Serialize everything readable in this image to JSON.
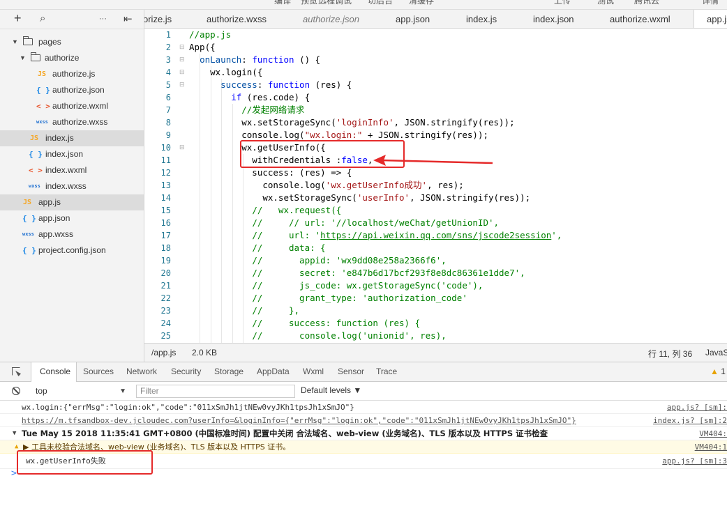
{
  "menu_strip": [
    "编译",
    "预览",
    "远程调试",
    "切后台",
    "清缓存",
    "上传",
    "测试",
    "腾讯云",
    "详情"
  ],
  "explorer": {
    "toolbar": {
      "add": "+",
      "search": "⌕",
      "more": "···",
      "collapse": "⇤"
    },
    "tree": [
      {
        "label": "pages",
        "type": "folder",
        "level": 0,
        "open": true
      },
      {
        "label": "authorize",
        "type": "folder",
        "level": 1,
        "open": true
      },
      {
        "label": "authorize.js",
        "type": "js",
        "level": 2
      },
      {
        "label": "authorize.json",
        "type": "json",
        "level": 2
      },
      {
        "label": "authorize.wxml",
        "type": "wxml",
        "level": 2
      },
      {
        "label": "authorize.wxss",
        "type": "wxss",
        "level": 2
      },
      {
        "label": "index.js",
        "type": "js",
        "level": 1,
        "selected": true
      },
      {
        "label": "index.json",
        "type": "json",
        "level": 1
      },
      {
        "label": "index.wxml",
        "type": "wxml",
        "level": 1
      },
      {
        "label": "index.wxss",
        "type": "wxss",
        "level": 1
      },
      {
        "label": "app.js",
        "type": "js",
        "level": 0,
        "selected": true
      },
      {
        "label": "app.json",
        "type": "json",
        "level": 0
      },
      {
        "label": "app.wxss",
        "type": "wxss",
        "level": 0
      },
      {
        "label": "project.config.json",
        "type": "json",
        "level": 0
      }
    ],
    "icons": {
      "js": "JS",
      "json": "{ }",
      "wxml": "< >",
      "wxss": "wxss"
    }
  },
  "tabs": [
    {
      "label": "orize.js"
    },
    {
      "label": "authorize.wxss"
    },
    {
      "label": "authorize.json",
      "italic": true
    },
    {
      "label": "app.json"
    },
    {
      "label": "index.js"
    },
    {
      "label": "index.json"
    },
    {
      "label": "authorize.wxml"
    },
    {
      "label": "app.js",
      "active": true
    }
  ],
  "editor": {
    "line_numbers": [
      "1",
      "2",
      "3",
      "4",
      "5",
      "6",
      "7",
      "8",
      "9",
      "10",
      "11",
      "12",
      "13",
      "14",
      "15",
      "16",
      "17",
      "18",
      "19",
      "20",
      "21",
      "22",
      "23",
      "24",
      "25"
    ]
  },
  "statusbar": {
    "path": "/app.js",
    "size": "2.0 KB",
    "position": "行 11, 列 36",
    "language": "JavaS"
  },
  "devtools": {
    "tabs": [
      "Console",
      "Sources",
      "Network",
      "Security",
      "Storage",
      "AppData",
      "Wxml",
      "Sensor",
      "Trace"
    ],
    "warning_count": "1",
    "context": "top",
    "filter_placeholder": "Filter",
    "levels": "Default levels ▼",
    "messages": [
      {
        "text": "wx.login:{\"errMsg\":\"login:ok\",\"code\":\"011xSmJh1jtNEw0vyJKh1tpsJh1xSmJO\"}",
        "source": "app.js? [sm]:"
      },
      {
        "text": "https://m.tfsandbox-dev.jcloudec.com?userInfo=&loginInfo={\"errMsg\":\"login:ok\",\"code\":\"011xSmJh1jtNEw0vyJKh1tpsJh1xSmJO\"}",
        "source": "index.js? [sm]:2"
      },
      {
        "text": "Tue May 15 2018 11:35:41 GMT+0800 (中国标准时间) 配置中关闭 合法域名、web-view (业务域名)、TLS 版本以及 HTTPS 证书检查",
        "source": "VM404:"
      },
      {
        "text": "▶ 工具未校验合法域名、web-view (业务域名)、TLS 版本以及 HTTPS 证书。",
        "source": "VM404:1"
      },
      {
        "text": "wx.getUserInfo失败",
        "source": "app.js? [sm]:3"
      }
    ],
    "prompt": ">"
  },
  "colors": {
    "annotation": "#e52a2a",
    "comment": "#008000",
    "keyword": "#0000ff",
    "string": "#a31515",
    "line_number": "#237893"
  }
}
